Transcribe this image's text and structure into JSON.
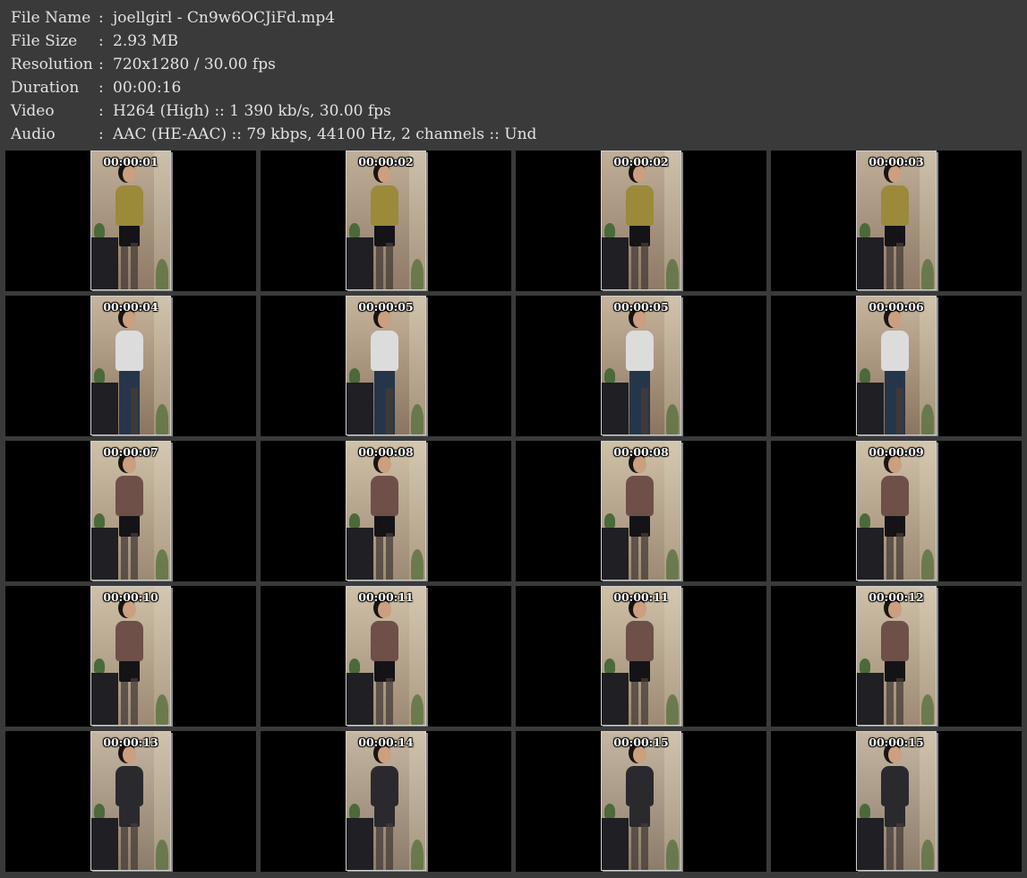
{
  "info": [
    {
      "label": "File Name",
      "value": "joellgirl - Cn9w6OCJiFd.mp4"
    },
    {
      "label": "File Size",
      "value": "2.93 MB"
    },
    {
      "label": "Resolution",
      "value": "720x1280 / 30.00 fps"
    },
    {
      "label": "Duration",
      "value": "00:00:16"
    },
    {
      "label": "Video",
      "value": "H264 (High) :: 1 390 kb/s, 30.00 fps"
    },
    {
      "label": "Audio",
      "value": "AAC (HE-AAC) :: 79 kbps, 44100 Hz, 2 channels :: Und"
    }
  ],
  "colors": {
    "background": "#3a3a3a",
    "cell": "#000000",
    "text": "#e2e2e2",
    "outfit_green": "#9a8a3a",
    "outfit_white": "#dcdcdc",
    "outfit_brown": "#6e5048",
    "outfit_black": "#2a2a2e",
    "jeans": "#26364a",
    "skirt": "#141416"
  },
  "thumbnails": [
    {
      "time": "00:00:01",
      "outfit": "green-sweater-skirt"
    },
    {
      "time": "00:00:02",
      "outfit": "green-sweater-skirt"
    },
    {
      "time": "00:00:02",
      "outfit": "green-sweater-skirt"
    },
    {
      "time": "00:00:03",
      "outfit": "green-sweater-skirt"
    },
    {
      "time": "00:00:04",
      "outfit": "white-tank-jeans"
    },
    {
      "time": "00:00:05",
      "outfit": "white-tank-jeans"
    },
    {
      "time": "00:00:05",
      "outfit": "white-tank-jeans"
    },
    {
      "time": "00:00:06",
      "outfit": "white-tank-jeans"
    },
    {
      "time": "00:00:07",
      "outfit": "brown-cardigan-skirt"
    },
    {
      "time": "00:00:08",
      "outfit": "brown-cardigan-skirt"
    },
    {
      "time": "00:00:08",
      "outfit": "brown-cardigan-skirt"
    },
    {
      "time": "00:00:09",
      "outfit": "brown-cardigan-skirt"
    },
    {
      "time": "00:00:10",
      "outfit": "brown-cardigan-skirt"
    },
    {
      "time": "00:00:11",
      "outfit": "brown-cardigan-skirt"
    },
    {
      "time": "00:00:11",
      "outfit": "brown-cardigan-skirt"
    },
    {
      "time": "00:00:12",
      "outfit": "brown-cardigan-skirt"
    },
    {
      "time": "00:00:13",
      "outfit": "black-dress"
    },
    {
      "time": "00:00:14",
      "outfit": "black-dress"
    },
    {
      "time": "00:00:15",
      "outfit": "black-dress"
    },
    {
      "time": "00:00:15",
      "outfit": "black-dress"
    }
  ]
}
